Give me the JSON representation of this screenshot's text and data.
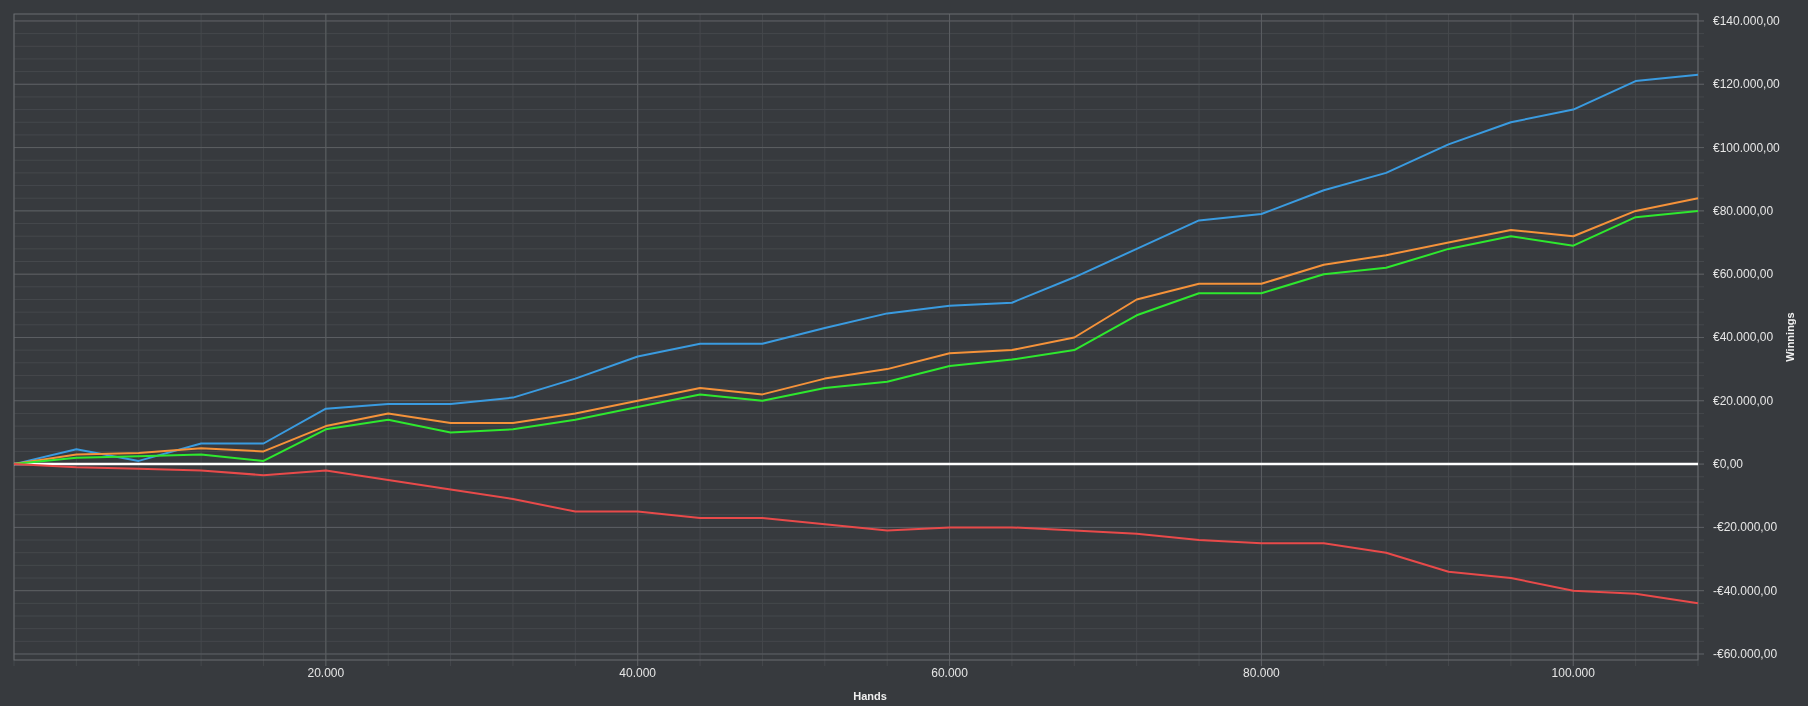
{
  "chart": {
    "chart_data": {
      "type": "line",
      "xlabel": "Hands",
      "ylabel": "Winnings",
      "x": [
        0,
        4000,
        8000,
        12000,
        16000,
        20000,
        24000,
        28000,
        32000,
        36000,
        40000,
        44000,
        48000,
        52000,
        56000,
        60000,
        64000,
        68000,
        72000,
        76000,
        80000,
        84000,
        88000,
        92000,
        96000,
        100000,
        104000,
        108000
      ],
      "series": [
        {
          "color": "#3a9be0",
          "values": [
            0,
            4700,
            1000,
            6500,
            6500,
            17500,
            19000,
            19000,
            21000,
            27000,
            34000,
            38000,
            38000,
            43000,
            47600,
            50000,
            51000,
            59000,
            68000,
            77000,
            79000,
            86500,
            92000,
            101000,
            108000,
            112000,
            121000,
            123000
          ]
        },
        {
          "color": "#f5923a",
          "values": [
            0,
            3000,
            3500,
            5000,
            4000,
            12000,
            16000,
            13000,
            13000,
            16000,
            20000,
            24000,
            22000,
            27000,
            30000,
            35000,
            36000,
            40000,
            52000,
            57000,
            57000,
            63000,
            66000,
            70000,
            74000,
            72000,
            80000,
            84000
          ]
        },
        {
          "color": "#2ee82e",
          "values": [
            0,
            2000,
            2500,
            3000,
            1000,
            11000,
            14000,
            10000,
            11000,
            14000,
            18000,
            22000,
            20000,
            24000,
            26000,
            31000,
            33000,
            36000,
            47000,
            54000,
            54000,
            60000,
            62000,
            68000,
            72000,
            69000,
            78000,
            80000
          ]
        },
        {
          "color": "#e84a4a",
          "values": [
            0,
            -1000,
            -1500,
            -2000,
            -3500,
            -2000,
            -5000,
            -8000,
            -11000,
            -15000,
            -15000,
            -17000,
            -17000,
            -19000,
            -21000,
            -20000,
            -20000,
            -21000,
            -22000,
            -24000,
            -25000,
            -25000,
            -28000,
            -34000,
            -36000,
            -40000,
            -41000,
            -44000
          ]
        }
      ],
      "xlim": [
        0,
        108000
      ],
      "ylim": [
        -61900,
        142200
      ],
      "xticks": [
        {
          "value": 20000,
          "label": "20.000"
        },
        {
          "value": 40000,
          "label": "40.000"
        },
        {
          "value": 60000,
          "label": "60.000"
        },
        {
          "value": 80000,
          "label": "80.000"
        },
        {
          "value": 100000,
          "label": "100.000"
        }
      ],
      "yticks": [
        {
          "value": 140000,
          "label": "€140.000,00"
        },
        {
          "value": 120000,
          "label": "€120.000,00"
        },
        {
          "value": 100000,
          "label": "€100.000,00"
        },
        {
          "value": 80000,
          "label": "€80.000,00"
        },
        {
          "value": 60000,
          "label": "€60.000,00"
        },
        {
          "value": 40000,
          "label": "€40.000,00"
        },
        {
          "value": 20000,
          "label": "€20.000,00"
        },
        {
          "value": 0,
          "label": "€0,00"
        },
        {
          "value": -20000,
          "label": "-€20.000,00"
        },
        {
          "value": -40000,
          "label": "-€40.000,00"
        },
        {
          "value": -60000,
          "label": "-€60.000,00"
        }
      ],
      "grid": true,
      "ref_lines": [
        {
          "axis": "y",
          "value": 0,
          "color": "#ffffff"
        }
      ]
    }
  }
}
